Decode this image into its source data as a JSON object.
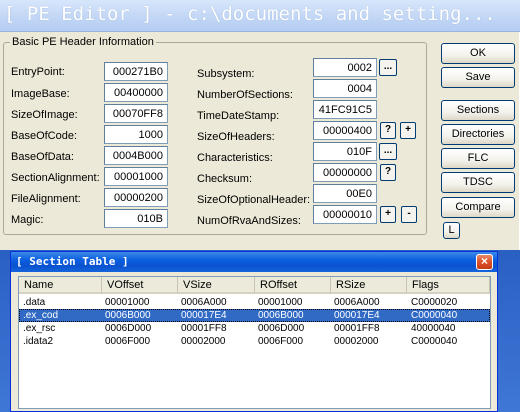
{
  "pe_window": {
    "title": "[ PE Editor ] - c:\\documents and setting...",
    "group_label": "Basic PE Header Information",
    "left_fields": [
      {
        "label": "EntryPoint:",
        "value": "000271B0"
      },
      {
        "label": "ImageBase:",
        "value": "00400000"
      },
      {
        "label": "SizeOfImage:",
        "value": "00070FF8"
      },
      {
        "label": "BaseOfCode:",
        "value": "1000"
      },
      {
        "label": "BaseOfData:",
        "value": "0004B000"
      },
      {
        "label": "SectionAlignment:",
        "value": "00001000"
      },
      {
        "label": "FileAlignment:",
        "value": "00000200"
      },
      {
        "label": "Magic:",
        "value": "010B"
      }
    ],
    "right_fields": [
      {
        "label": "Subsystem:",
        "value": "0002"
      },
      {
        "label": "NumberOfSections:",
        "value": "0004"
      },
      {
        "label": "TimeDateStamp:",
        "value": "41FC91C5"
      },
      {
        "label": "SizeOfHeaders:",
        "value": "00000400"
      },
      {
        "label": "Characteristics:",
        "value": "010F"
      },
      {
        "label": "Checksum:",
        "value": "00000000"
      },
      {
        "label": "SizeOfOptionalHeader:",
        "value": "00E0"
      },
      {
        "label": "NumOfRvaAndSizes:",
        "value": "00000010"
      }
    ],
    "small_buttons": {
      "ellipsis": "...",
      "question": "?",
      "plus": "+",
      "minus": "-"
    },
    "buttons": {
      "ok": "OK",
      "save": "Save",
      "sections": "Sections",
      "directories": "Directories",
      "flc": "FLC",
      "tdsc": "TDSC",
      "compare": "Compare",
      "l": "L"
    }
  },
  "section_table": {
    "title": "[ Section Table ]",
    "close_glyph": "×",
    "columns": [
      "Name",
      "VOffset",
      "VSize",
      "ROffset",
      "RSize",
      "Flags"
    ],
    "rows": [
      [
        ".data",
        "00001000",
        "0006A000",
        "00001000",
        "0006A000",
        "C0000020"
      ],
      [
        ".ex_cod",
        "0006B000",
        "000017E4",
        "0006B000",
        "000017E4",
        "C0000040"
      ],
      [
        ".ex_rsc",
        "0006D000",
        "00001FF8",
        "0006D000",
        "00001FF8",
        "40000040"
      ],
      [
        ".idata2",
        "0006F000",
        "00002000",
        "0006F000",
        "00002000",
        "C0000040"
      ]
    ],
    "selected_row": 1
  }
}
